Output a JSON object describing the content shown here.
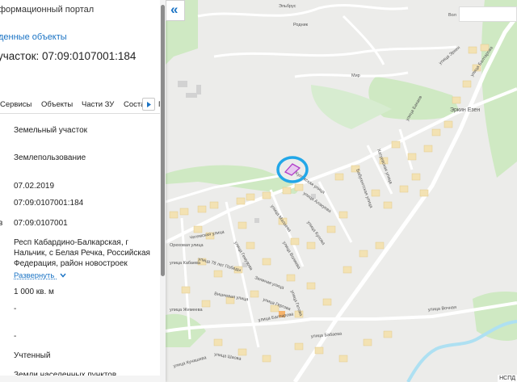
{
  "panel": {
    "portal_label": "формационный портал",
    "found_objects_link": "денные объекты",
    "parcel_title": "участок: 07:09:0107001:184",
    "tabs": [
      {
        "label": "Сервисы"
      },
      {
        "label": "Объекты"
      },
      {
        "label": "Части ЗУ"
      },
      {
        "label": "Соста"
      }
    ],
    "tab_cut": "П",
    "fields": {
      "object_type": "Земельный участок",
      "category": "Землепользование",
      "date": "07.02.2019",
      "cadastral_number": "07:09:0107001:184",
      "quarter_prefix": "в",
      "quarter": "07:09:0107001",
      "address": "Респ Кабардино-Балкарская, г Нальчик, с Белая Речка, Российская Федерация, район новостроек",
      "expand_label": "Развернуть",
      "area": "1 000 кв. м",
      "dash_1": "-",
      "dash_2": "-",
      "status": "Учтенный",
      "land_category": "Земли населенных пунктов"
    }
  },
  "map": {
    "collapse_glyph": "«",
    "attribution": "НСПД",
    "street_labels": [
      {
        "text": "Эльбрус"
      },
      {
        "text": "Родник"
      },
      {
        "text": "Вол"
      },
      {
        "text": "улица Эркен"
      },
      {
        "text": "улица Балтарова"
      },
      {
        "text": "Мир"
      },
      {
        "text": "Эркин Езен"
      },
      {
        "text": "улица Бакаев"
      },
      {
        "text": "Хатуевская улица"
      },
      {
        "text": "Бабугентская улица"
      },
      {
        "text": "Кулужская улица"
      },
      {
        "text": "улица Алакуева"
      },
      {
        "text": "улица Малаева"
      },
      {
        "text": "улица Кулова"
      },
      {
        "text": "улица Волиева"
      },
      {
        "text": "Зеленая улица"
      },
      {
        "text": "улица Гетова"
      },
      {
        "text": "улица Гергова"
      },
      {
        "text": "Вишневая улица"
      },
      {
        "text": "улица Гемузова"
      },
      {
        "text": "улица 78 лет Победы"
      },
      {
        "text": "Чегемская улица"
      },
      {
        "text": "Ореховая улица"
      },
      {
        "text": "улица Кабаева"
      },
      {
        "text": "улица Балтарова"
      },
      {
        "text": "улица Бабаева"
      },
      {
        "text": "улица Жемеева"
      },
      {
        "text": "улица Вочная"
      },
      {
        "text": "улица Кунашева"
      },
      {
        "text": "улица Шаова"
      }
    ],
    "colors": {
      "background": "#ececea",
      "forest": "#cfe9c3",
      "lots": "#f3e2b3",
      "highlight": "#22a7e8",
      "parcel": "#b03cc8"
    }
  }
}
